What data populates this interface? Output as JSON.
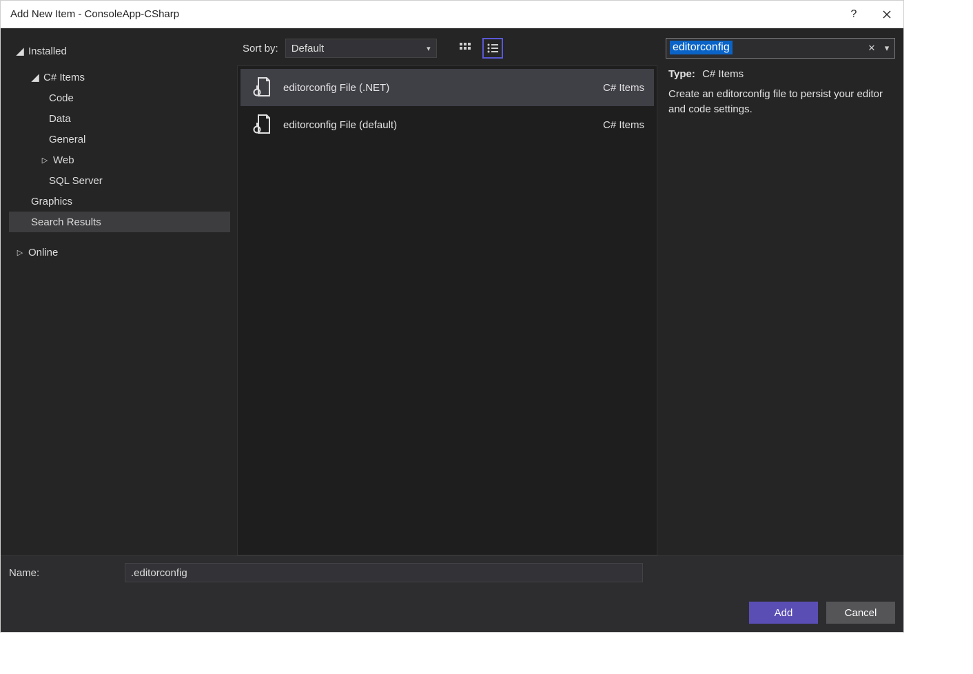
{
  "window": {
    "title": "Add New Item - ConsoleApp-CSharp"
  },
  "sidebar": {
    "installed": "Installed",
    "csharp_items": "C# Items",
    "items": {
      "code": "Code",
      "data": "Data",
      "general": "General",
      "web": "Web",
      "sqlserver": "SQL Server"
    },
    "graphics": "Graphics",
    "search_results": "Search Results",
    "online": "Online"
  },
  "toolbar": {
    "sort_label": "Sort by:",
    "sort_value": "Default"
  },
  "templates": [
    {
      "title": "editorconfig File (.NET)",
      "category": "C# Items",
      "selected": true
    },
    {
      "title": "editorconfig File (default)",
      "category": "C# Items",
      "selected": false
    }
  ],
  "search": {
    "value": "editorconfig"
  },
  "details": {
    "type_label": "Type:",
    "type_value": "C# Items",
    "description": "Create an editorconfig file to persist your editor and code settings."
  },
  "footer": {
    "name_label": "Name:",
    "name_value": ".editorconfig",
    "add": "Add",
    "cancel": "Cancel"
  }
}
